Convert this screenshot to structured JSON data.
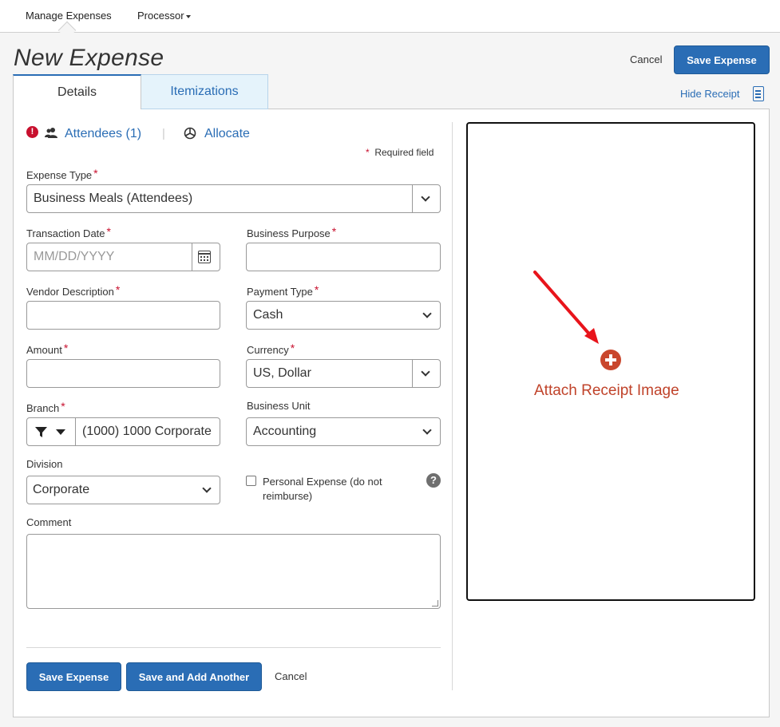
{
  "nav": {
    "items": [
      "Manage Expenses",
      "Processor"
    ]
  },
  "header": {
    "title": "New Expense",
    "cancel": "Cancel",
    "save": "Save Expense",
    "hide_receipt": "Hide Receipt"
  },
  "tabs": [
    "Details",
    "Itemizations"
  ],
  "links": {
    "attendees": "Attendees (1)",
    "allocate": "Allocate"
  },
  "required_note": {
    "star": "*",
    "text": "Required field"
  },
  "form": {
    "expense_type": {
      "label": "Expense Type",
      "value": "Business Meals (Attendees)",
      "required": "*"
    },
    "transaction_date": {
      "label": "Transaction Date",
      "placeholder": "MM/DD/YYYY",
      "required": "*"
    },
    "business_purpose": {
      "label": "Business Purpose",
      "value": "",
      "required": "*"
    },
    "vendor_description": {
      "label": "Vendor Description",
      "value": "",
      "required": "*"
    },
    "payment_type": {
      "label": "Payment Type",
      "value": "Cash",
      "required": "*"
    },
    "amount": {
      "label": "Amount",
      "value": "",
      "required": "*"
    },
    "currency": {
      "label": "Currency",
      "value": "US, Dollar",
      "required": "*"
    },
    "branch": {
      "label": "Branch",
      "value": "(1000) 1000 Corporate",
      "required": "*"
    },
    "business_unit": {
      "label": "Business Unit",
      "value": "Accounting"
    },
    "division": {
      "label": "Division",
      "value": "Corporate"
    },
    "personal_expense": {
      "label": "Personal Expense (do not reimburse)",
      "checked": false
    },
    "comment": {
      "label": "Comment",
      "value": ""
    }
  },
  "buttons": {
    "save": "Save Expense",
    "save_another": "Save and Add Another",
    "cancel": "Cancel"
  },
  "receipt": {
    "attach_label": "Attach Receipt Image"
  },
  "colors": {
    "primary": "#2a6db5",
    "required": "#c8102e",
    "attach": "#c0432a",
    "tab_inactive": "#e5f3fb"
  }
}
